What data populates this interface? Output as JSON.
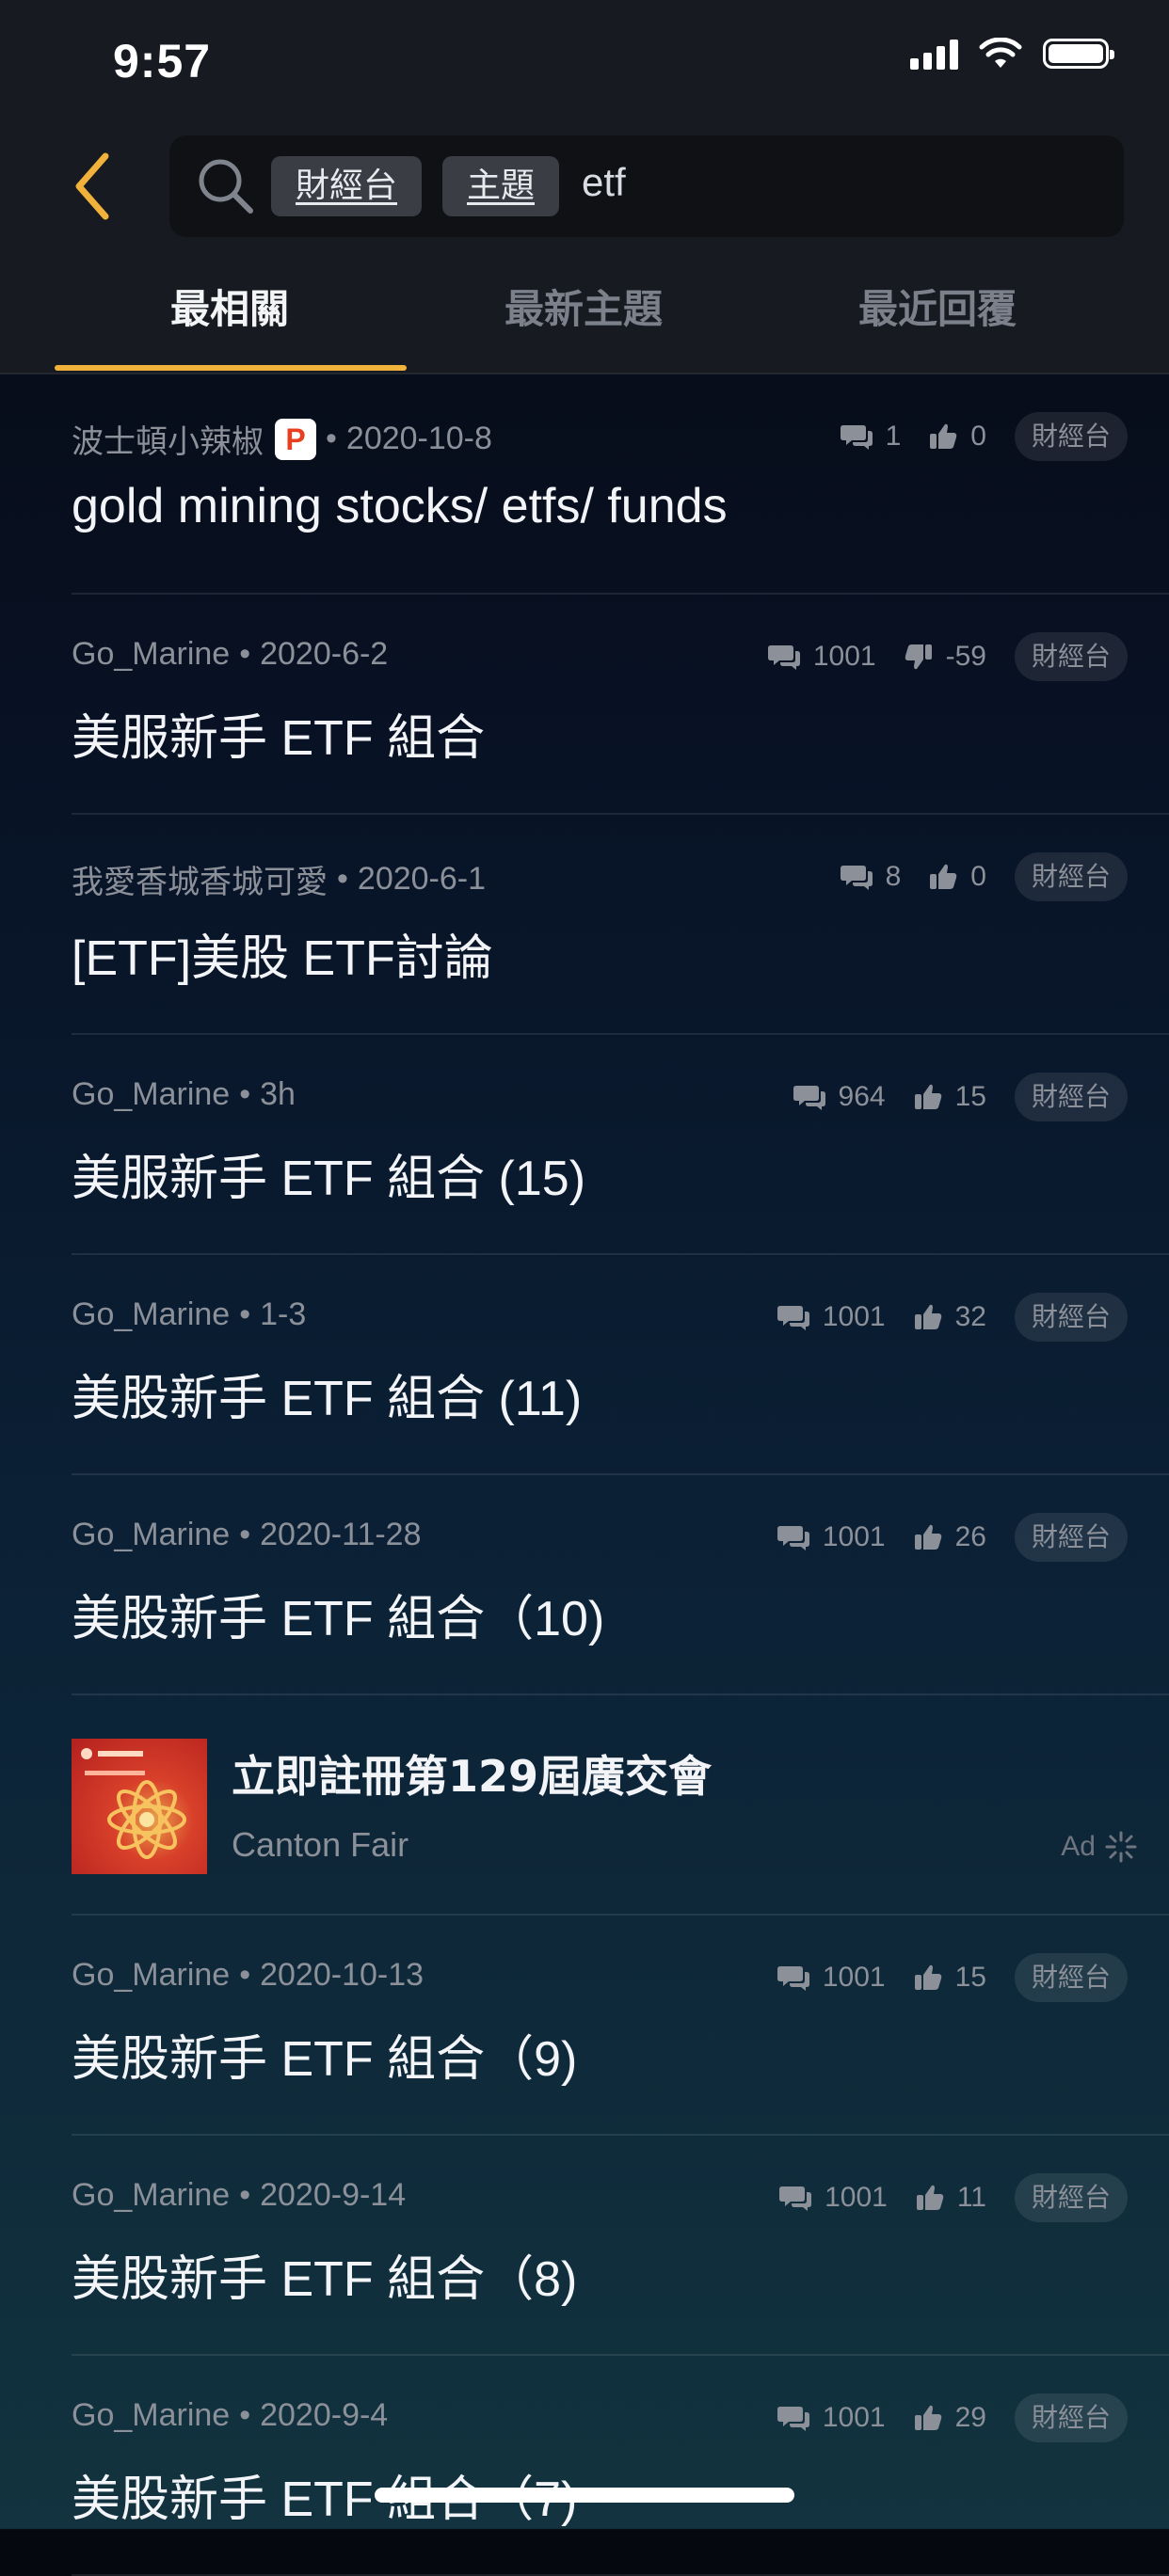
{
  "status_bar": {
    "time": "9:57"
  },
  "search": {
    "chips": [
      "財經台",
      "主題"
    ],
    "query": "etf"
  },
  "tabs": [
    {
      "label": "最相關",
      "active": true
    },
    {
      "label": "最新主題",
      "active": false
    },
    {
      "label": "最近回覆",
      "active": false
    }
  ],
  "posts": [
    {
      "author": "波士頓小辣椒",
      "badge": "P",
      "date": "2020-10-8",
      "title": "gold mining stocks/ etfs/ funds",
      "comments": "1",
      "likes": "0",
      "like_type": "up",
      "board": "財經台"
    },
    {
      "author": "Go_Marine",
      "date": "2020-6-2",
      "title": "美服新手 ETF 組合",
      "comments": "1001",
      "likes": "-59",
      "like_type": "down",
      "board": "財經台"
    },
    {
      "author": "我愛香城香城可愛",
      "date": "2020-6-1",
      "title": "[ETF]美股 ETF討論",
      "comments": "8",
      "likes": "0",
      "like_type": "up",
      "board": "財經台"
    },
    {
      "author": "Go_Marine",
      "date": "3h",
      "title": "美服新手 ETF 組合 (15)",
      "comments": "964",
      "likes": "15",
      "like_type": "up",
      "board": "財經台"
    },
    {
      "author": "Go_Marine",
      "date": "1-3",
      "title": "美股新手 ETF 組合 (11)",
      "comments": "1001",
      "likes": "32",
      "like_type": "up",
      "board": "財經台"
    },
    {
      "author": "Go_Marine",
      "date": "2020-11-28",
      "title": "美股新手 ETF 組合（10)",
      "comments": "1001",
      "likes": "26",
      "like_type": "up",
      "board": "財經台"
    }
  ],
  "ad": {
    "title": "立即註冊第129屆廣交會",
    "sponsor": "Canton Fair",
    "label": "Ad"
  },
  "posts_after_ad": [
    {
      "author": "Go_Marine",
      "date": "2020-10-13",
      "title": "美股新手 ETF 組合（9)",
      "comments": "1001",
      "likes": "15",
      "like_type": "up",
      "board": "財經台"
    },
    {
      "author": "Go_Marine",
      "date": "2020-9-14",
      "title": "美股新手 ETF 組合（8)",
      "comments": "1001",
      "likes": "11",
      "like_type": "up",
      "board": "財經台"
    },
    {
      "author": "Go_Marine",
      "date": "2020-9-4",
      "title": "美股新手 ETF 組合（7)",
      "comments": "1001",
      "likes": "29",
      "like_type": "up",
      "board": "財經台"
    }
  ],
  "colors": {
    "accent": "#f0b23a",
    "header_bg": "#171a20",
    "p_badge": "#e8401f"
  }
}
